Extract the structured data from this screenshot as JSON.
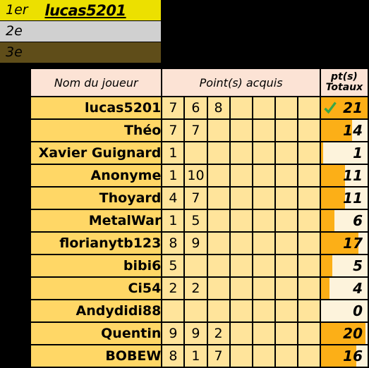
{
  "podium": {
    "rows": [
      {
        "rank": "1er",
        "name": "lucas5201",
        "medal": "gold"
      },
      {
        "rank": "2e",
        "name": "",
        "medal": "silver"
      },
      {
        "rank": "3e",
        "name": "",
        "medal": "bronze"
      }
    ]
  },
  "table": {
    "headers": {
      "name": "Nom du joueur",
      "points": "Point(s) acquis",
      "total_line1": "pt(s)",
      "total_line2": "Totaux"
    },
    "point_column_count": 7,
    "max_total": 21,
    "check_icon": "check-icon",
    "rows": [
      {
        "name": "lucas5201",
        "points": [
          "7",
          "6",
          "8",
          "",
          "",
          "",
          ""
        ],
        "total": "21",
        "bar": 21,
        "leader": true
      },
      {
        "name": "Théo",
        "points": [
          "7",
          "7",
          "",
          "",
          "",
          "",
          ""
        ],
        "total": "14",
        "bar": 14,
        "leader": false
      },
      {
        "name": "Xavier Guignard",
        "points": [
          "1",
          "",
          "",
          "",
          "",
          "",
          ""
        ],
        "total": "1",
        "bar": 1,
        "leader": false
      },
      {
        "name": "Anonyme",
        "points": [
          "1",
          "10",
          "",
          "",
          "",
          "",
          ""
        ],
        "total": "11",
        "bar": 11,
        "leader": false
      },
      {
        "name": "Thoyard",
        "points": [
          "4",
          "7",
          "",
          "",
          "",
          "",
          ""
        ],
        "total": "11",
        "bar": 11,
        "leader": false
      },
      {
        "name": "MetalWar",
        "points": [
          "1",
          "5",
          "",
          "",
          "",
          "",
          ""
        ],
        "total": "6",
        "bar": 6,
        "leader": false
      },
      {
        "name": "florianytb123",
        "points": [
          "8",
          "9",
          "",
          "",
          "",
          "",
          ""
        ],
        "total": "17",
        "bar": 17,
        "leader": false
      },
      {
        "name": "bibi6",
        "points": [
          "5",
          "",
          "",
          "",
          "",
          "",
          ""
        ],
        "total": "5",
        "bar": 5,
        "leader": false
      },
      {
        "name": "Ci54",
        "points": [
          "2",
          "2",
          "",
          "",
          "",
          "",
          ""
        ],
        "total": "4",
        "bar": 4,
        "leader": false
      },
      {
        "name": "Andydidi88",
        "points": [
          "",
          "",
          "",
          "",
          "",
          "",
          ""
        ],
        "total": "0",
        "bar": 0,
        "leader": false
      },
      {
        "name": "Quentin",
        "points": [
          "9",
          "9",
          "2",
          "",
          "",
          "",
          ""
        ],
        "total": "20",
        "bar": 20,
        "leader": false
      },
      {
        "name": "BOBEW",
        "points": [
          "8",
          "1",
          "7",
          "",
          "",
          "",
          ""
        ],
        "total": "16",
        "bar": 16,
        "leader": false
      }
    ]
  },
  "colors": {
    "gold": "#ece000",
    "silver": "#d0d0d0",
    "bronze": "#5f4d19",
    "header_bg": "#fce3d5",
    "name_bg": "#ffd766",
    "point_bg": "#ffe49b",
    "total_bg": "#fdf3dc",
    "bar": "#fcaf17",
    "check": "#3aa648",
    "background": "#000000"
  }
}
